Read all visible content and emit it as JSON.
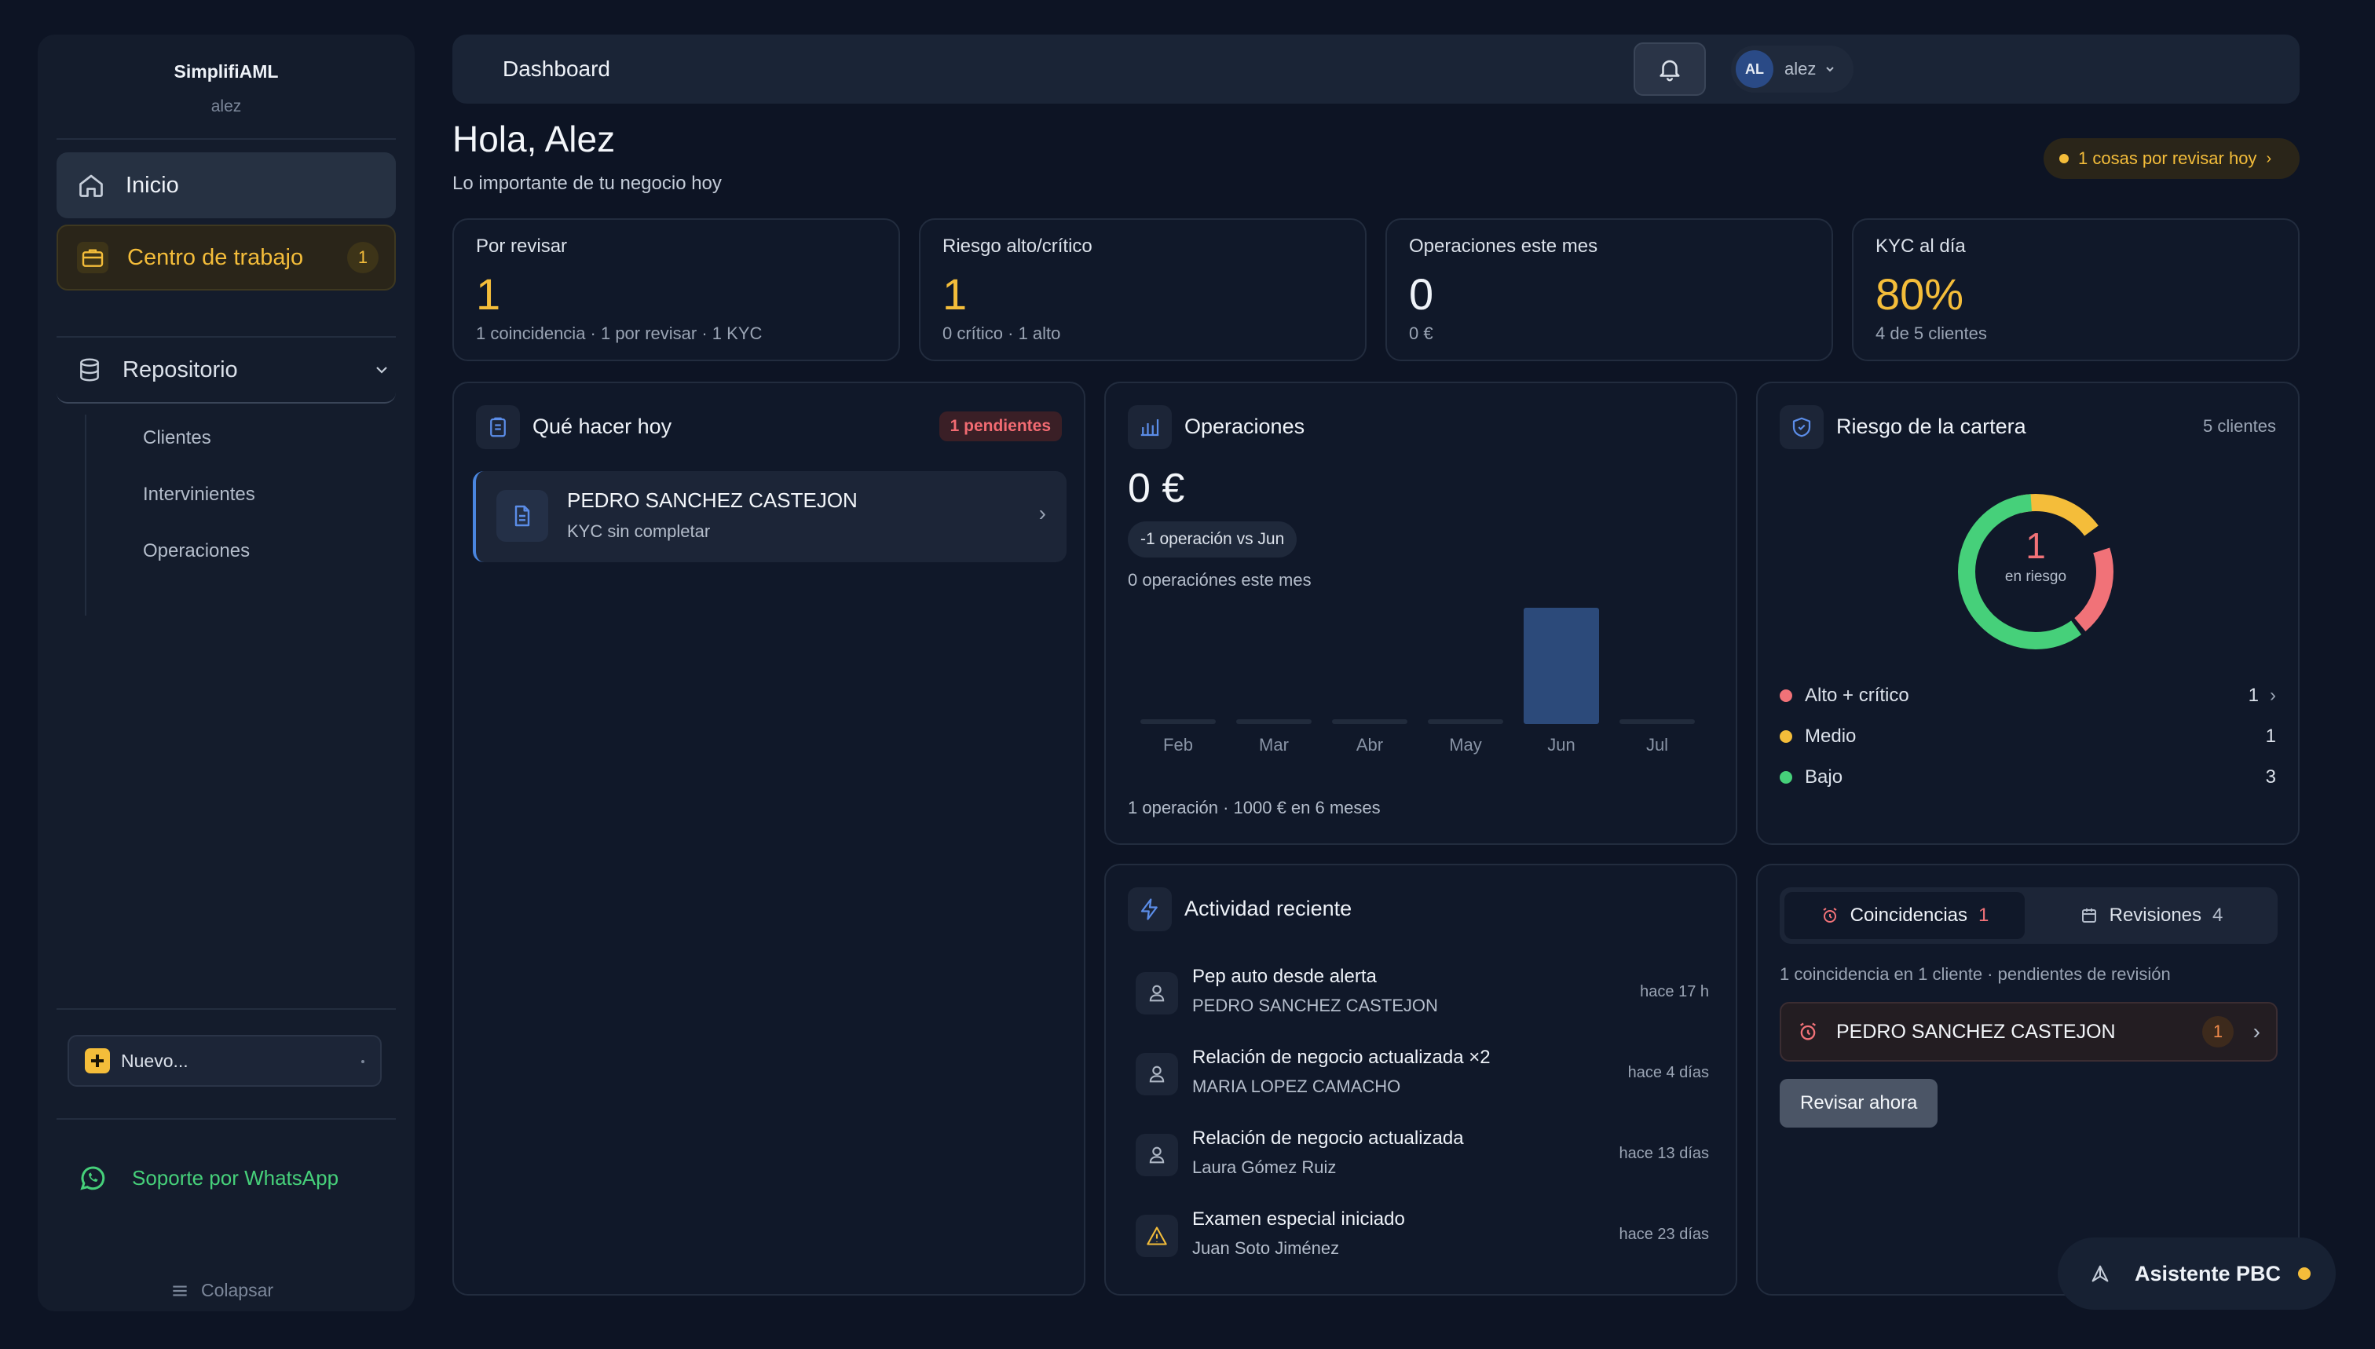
{
  "sidebar": {
    "brand": "SimplifiAML",
    "user": "alez",
    "nav": {
      "home": "Inicio",
      "workcenter": "Centro de trabajo",
      "workcenter_badge": "1",
      "repository": "Repositorio"
    },
    "repository_items": [
      "Clientes",
      "Intervinientes",
      "Operaciones"
    ],
    "new_button": "Nuevo...",
    "support": "Soporte por WhatsApp",
    "collapse": "Colapsar"
  },
  "topbar": {
    "title": "Dashboard",
    "avatar_initials": "AL",
    "user": "alez"
  },
  "greeting": {
    "title": "Hola, Alez",
    "subtitle": "Lo importante de tu negocio hoy",
    "pill": "1 cosas por revisar hoy"
  },
  "kpis": [
    {
      "label": "Por revisar",
      "value": "1",
      "sub": "1 coincidencia · 1 por revisar · 1 KYC",
      "color": "#f4bd3a"
    },
    {
      "label": "Riesgo alto/crítico",
      "value": "1",
      "sub": "0 crítico · 1 alto",
      "color": "#f4bd3a"
    },
    {
      "label": "Operaciones este mes",
      "value": "0",
      "sub": "0 €",
      "color": "#eef2f8"
    },
    {
      "label": "KYC al día",
      "value": "80%",
      "sub": "4 de 5 clientes",
      "color": "#f4bd3a"
    }
  ],
  "todo": {
    "title": "Qué hacer hoy",
    "badge": "1 pendientes",
    "items": [
      {
        "name": "PEDRO SANCHEZ CASTEJON",
        "detail": "KYC sin completar"
      }
    ]
  },
  "operations": {
    "title": "Operaciones",
    "value": "0 €",
    "delta": "-1 operación vs Jun",
    "sub": "0 operaciónes este mes",
    "footer": "1 operación · 1000 € en 6 meses"
  },
  "chart_data": {
    "type": "bar",
    "categories": [
      "Feb",
      "Mar",
      "Abr",
      "May",
      "Jun",
      "Jul"
    ],
    "values": [
      0,
      0,
      0,
      0,
      1000,
      0
    ],
    "ylim": [
      0,
      1000
    ],
    "bar_color": "#2c4a7a",
    "grid": false
  },
  "risk": {
    "title": "Riesgo de la cartera",
    "clients": "5 clientes",
    "center_value": "1",
    "center_label": "en riesgo",
    "segments": [
      {
        "label": "Alto + crítico",
        "value": 1,
        "count": "1",
        "color": "#f17278"
      },
      {
        "label": "Medio",
        "value": 1,
        "count": "1",
        "color": "#f4bd3a"
      },
      {
        "label": "Bajo",
        "value": 3,
        "count": "3",
        "color": "#46d07a"
      }
    ]
  },
  "activity": {
    "title": "Actividad reciente",
    "items": [
      {
        "title": "Pep auto desde alerta",
        "subject": "PEDRO SANCHEZ CASTEJON",
        "time": "hace 17 h",
        "icon": "user-icon"
      },
      {
        "title": "Relación de negocio actualizada ×2",
        "subject": "MARIA LOPEZ CAMACHO",
        "time": "hace 4 días",
        "icon": "user-icon"
      },
      {
        "title": "Relación de negocio actualizada",
        "subject": "Laura Gómez Ruiz",
        "time": "hace 13 días",
        "icon": "user-icon"
      },
      {
        "title": "Examen especial iniciado",
        "subject": "Juan Soto Jiménez",
        "time": "hace 23 días",
        "icon": "warning-icon"
      }
    ]
  },
  "matches": {
    "tabs": [
      {
        "label": "Coincidencias",
        "count": "1"
      },
      {
        "label": "Revisiones",
        "count": "4"
      }
    ],
    "summary": "1 coincidencia en 1 cliente · pendientes de revisión",
    "item": {
      "name": "PEDRO SANCHEZ CASTEJON",
      "count": "1"
    },
    "button": "Revisar ahora"
  },
  "assistant": {
    "label": "Asistente PBC"
  }
}
